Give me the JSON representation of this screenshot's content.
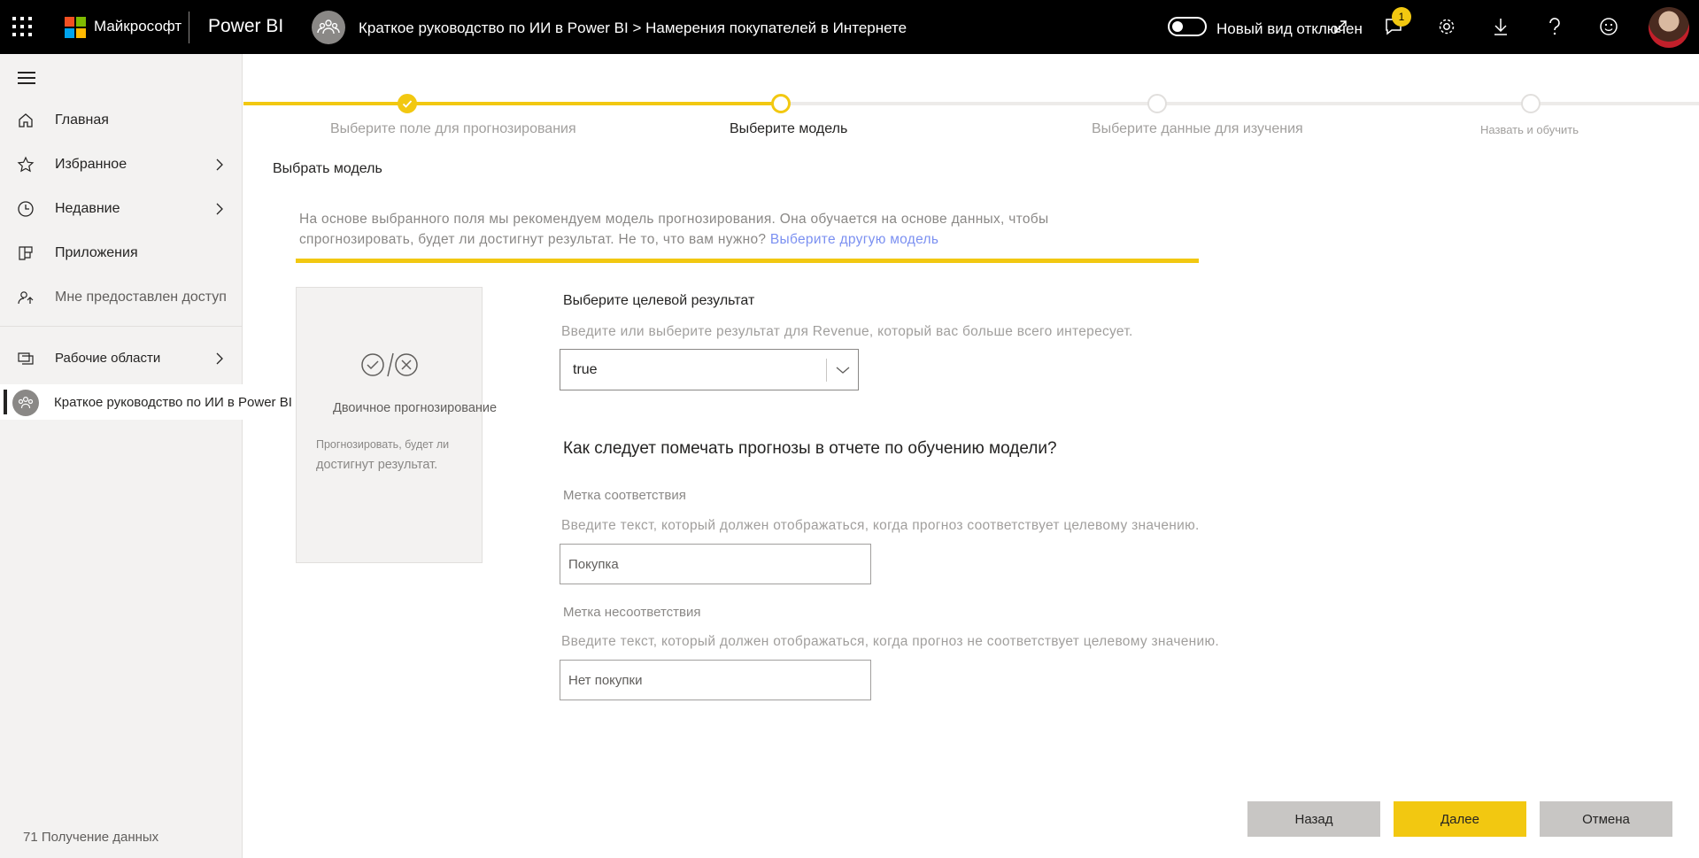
{
  "topbar": {
    "company": "Майкрософт",
    "product": "Power BI",
    "breadcrumb": "Краткое руководство по ИИ в Power BI > Намерения покупателей в Интернете",
    "toggle_label": "Новый вид отключен",
    "notification_count": "1",
    "icons": [
      "app-launcher-icon",
      "expand-icon",
      "notifications-icon",
      "settings-icon",
      "download-icon",
      "help-icon",
      "feedback-smiley-icon"
    ]
  },
  "nav": {
    "items": [
      {
        "label": "Главная",
        "icon": "home-icon"
      },
      {
        "label": "Избранное",
        "icon": "star-icon"
      },
      {
        "label": "Недавние",
        "icon": "clock-icon"
      },
      {
        "label": "Приложения",
        "icon": "apps-icon"
      },
      {
        "label": "Мне предоставлен доступ",
        "icon": "shared-icon"
      },
      {
        "label": "Рабочие области",
        "icon": "workspaces-icon"
      }
    ],
    "current_workspace": "Краткое руководство по ИИ в Power BI",
    "get_data": "71 Получение данных"
  },
  "stepper": {
    "steps": [
      {
        "label": "Выберите поле для прогнозирования",
        "state": "done"
      },
      {
        "label": "Выберите модель",
        "state": "current"
      },
      {
        "label": "Выберите данные для изучения",
        "state": "todo"
      },
      {
        "label": "Назвать и обучить",
        "state": "todo"
      }
    ],
    "accent": "#f2c811"
  },
  "main": {
    "section_title": "Выбрать модель",
    "recommendation_text": "На основе выбранного поля мы рекомендуем модель прогнозирования. Она обучается на основе данных, чтобы спрогнозировать, будет ли достигнут результат. Не то, что вам нужно?",
    "recommendation_link": "Выберите другую модель",
    "model_card": {
      "name": "Двоичное прогнозирование",
      "desc_line1": "Прогнозировать, будет ли",
      "desc_line2": "достигнут результат."
    },
    "target": {
      "heading": "Выберите целевой результат",
      "help": "Введите или выберите результат для Revenue, который вас больше всего интересует.",
      "value": "true"
    },
    "labels_question": "Как следует помечать прогнозы в отчете по обучению модели?",
    "match": {
      "heading": "Метка соответствия",
      "help": "Введите текст, который должен отображаться, когда прогноз соответствует целевому значению.",
      "placeholder": "Покупка"
    },
    "mismatch": {
      "heading": "Метка несоответствия",
      "help": "Введите текст, который должен отображаться, когда прогноз не соответствует целевому значению.",
      "placeholder": "Нет покупки"
    }
  },
  "footer": {
    "back": "Назад",
    "next": "Далее",
    "cancel": "Отмена"
  }
}
